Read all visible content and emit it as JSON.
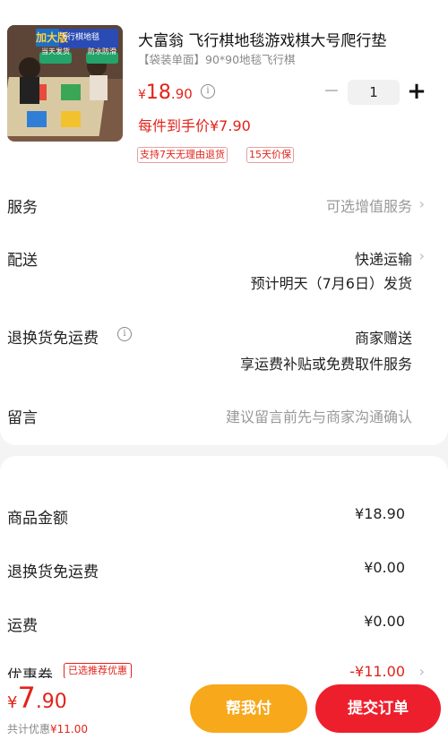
{
  "product": {
    "title": "大富翁 飞行棋地毯游戏棋大号爬行垫",
    "spec": "【袋装单面】90*90地毯飞行棋",
    "price_currency": "¥",
    "price_int": "18",
    "price_dec": ".90",
    "quantity": "1",
    "final_price_text": "每件到手价¥7.90",
    "tags": [
      "支持7天无理由退货",
      "15天价保"
    ],
    "image_texts": {
      "badge": "加大版",
      "sub": "飞行棋地毯",
      "left": "当天发货",
      "right": "防水防滑"
    }
  },
  "rows": {
    "service": {
      "label": "服务",
      "value": "可选增值服务"
    },
    "delivery": {
      "label": "配送",
      "value": "快递运输",
      "value2": "预计明天（7月6日）发货"
    },
    "return": {
      "label": "退换货免运费",
      "value": "商家赠送",
      "value2": "享运费补贴或免费取件服务"
    },
    "message": {
      "label": "留言",
      "placeholder": "建议留言前先与商家沟通确认"
    }
  },
  "summary": {
    "goods": {
      "label": "商品金额",
      "value": "¥18.90"
    },
    "return_fee": {
      "label": "退换货免运费",
      "value": "¥0.00"
    },
    "shipping": {
      "label": "运费",
      "value": "¥0.00"
    },
    "coupon": {
      "label": "优惠券",
      "tag": "已选推荐优惠",
      "value": "-¥11.00"
    }
  },
  "bottom": {
    "total_currency": "¥",
    "total_int": "7",
    "total_dec": ".90",
    "saved_label": "共计优惠",
    "saved_value": "¥11.00",
    "help_button": "帮我付",
    "pay_button": "提交订单"
  },
  "colors": {
    "accent": "#e2231a",
    "help": "#f7a81b",
    "pay": "#ee1f2d"
  }
}
